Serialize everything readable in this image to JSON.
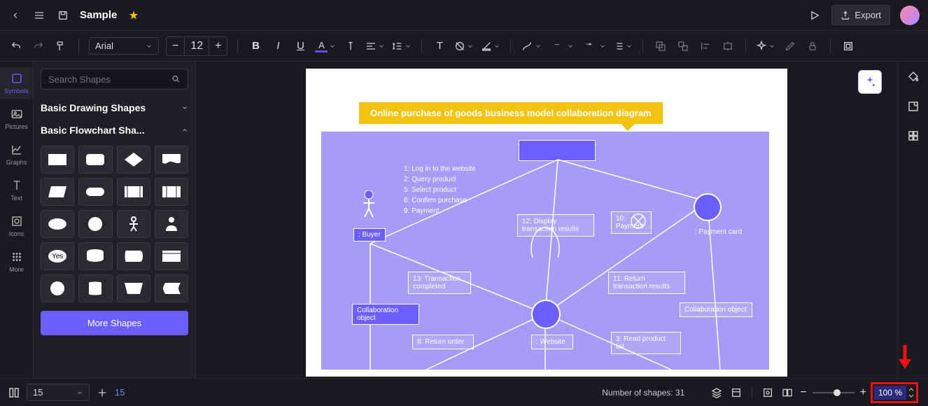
{
  "header": {
    "title": "Sample",
    "export_label": "Export"
  },
  "toolbar": {
    "font": "Arial",
    "font_size": "12"
  },
  "rail": {
    "symbols": "Symbols",
    "pictures": "Pictures",
    "graphs": "Graphs",
    "text": "Text",
    "icons": "Icons",
    "more": "More"
  },
  "panel": {
    "search_placeholder": "Search Shapes",
    "cat1": "Basic Drawing Shapes",
    "cat2": "Basic Flowchart Sha...",
    "yes_label": "Yes",
    "more_shapes": "More Shapes"
  },
  "diagram": {
    "title": "Online purchase of goods business model collaboration diagram",
    "steps": [
      "1: Log in to the website",
      "2: Query product",
      "5: Select product",
      "6: Confirm purchase",
      "9: Payment"
    ],
    "buyer": ": Buyer",
    "payment_card": ": Payment card",
    "website": ": Website",
    "display_trans": "12: Display transaction results",
    "payment10": "10: Payment",
    "trans_complete": "13: Transaction completed",
    "return_trans": "11: Return transaction results",
    "collab_obj": "Collaboration object",
    "return_order": "8: Return order",
    "read_product": "3: Read product list"
  },
  "bottom": {
    "page_val": "15",
    "page_label": "15",
    "shape_count_label": "Number of shapes: 31",
    "zoom_val": "100 %"
  }
}
